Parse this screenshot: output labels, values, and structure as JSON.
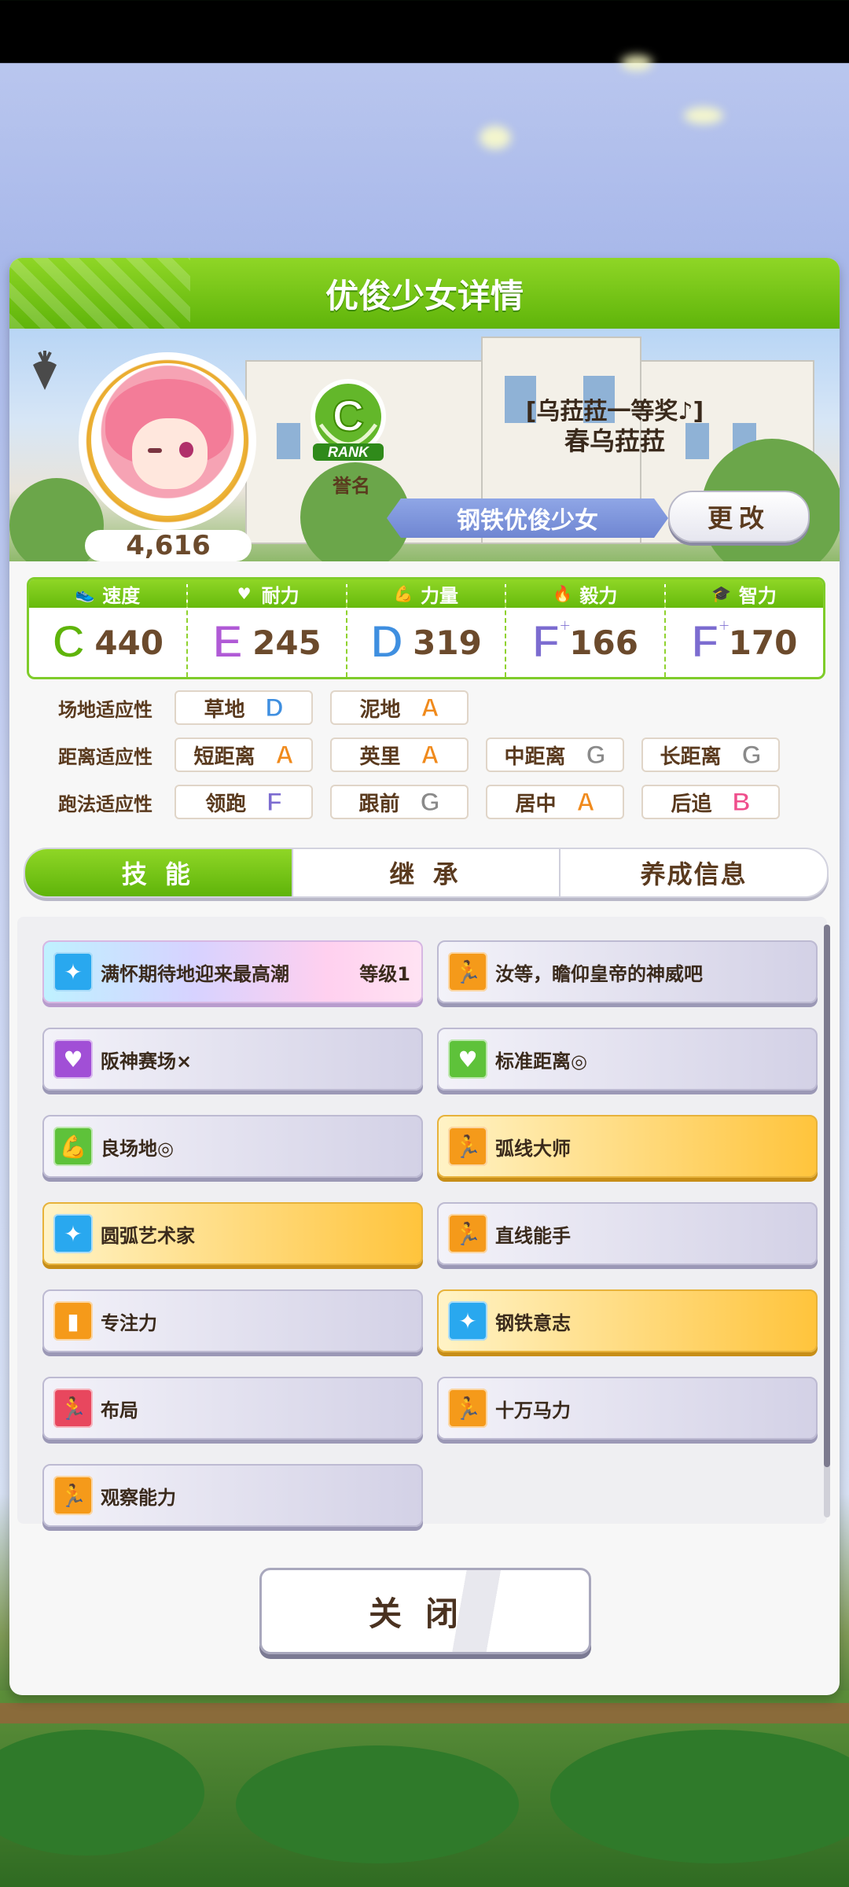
{
  "dialog": {
    "title": "优俊少女详情"
  },
  "profile": {
    "score": "4,616",
    "rank_letter": "C",
    "rank_text": "RANK",
    "rank_caption": "誉名",
    "title": "[乌菈菈一等奖♪]",
    "name": "春乌菈菈",
    "epithet": "钢铁优俊少女",
    "change_label": "更改"
  },
  "stats": [
    {
      "label": "速度",
      "icon": "shoe-icon",
      "grade": "C",
      "plus": "",
      "value": "440",
      "color": "#5fb40a"
    },
    {
      "label": "耐力",
      "icon": "heart-icon",
      "grade": "E",
      "plus": "",
      "value": "245",
      "color": "#b05ad6"
    },
    {
      "label": "力量",
      "icon": "muscle-icon",
      "grade": "D",
      "plus": "",
      "value": "319",
      "color": "#3f8fe0"
    },
    {
      "label": "毅力",
      "icon": "flame-icon",
      "grade": "F",
      "plus": "+",
      "value": "166",
      "color": "#7c6cd0"
    },
    {
      "label": "智力",
      "icon": "graduation-cap-icon",
      "grade": "F",
      "plus": "+",
      "value": "170",
      "color": "#7c6cd0"
    }
  ],
  "aptitude": {
    "rows": [
      {
        "label": "场地适应性",
        "cells": [
          {
            "name": "草地",
            "grade": "D",
            "color": "#3f8fe0"
          },
          {
            "name": "泥地",
            "grade": "A",
            "color": "#f08a1c"
          }
        ]
      },
      {
        "label": "距离适应性",
        "cells": [
          {
            "name": "短距离",
            "grade": "A",
            "color": "#f08a1c"
          },
          {
            "name": "英里",
            "grade": "A",
            "color": "#f08a1c"
          },
          {
            "name": "中距离",
            "grade": "G",
            "color": "#8a8a8a"
          },
          {
            "name": "长距离",
            "grade": "G",
            "color": "#8a8a8a"
          }
        ]
      },
      {
        "label": "跑法适应性",
        "cells": [
          {
            "name": "领跑",
            "grade": "F",
            "color": "#7c6cd0"
          },
          {
            "name": "跟前",
            "grade": "G",
            "color": "#8a8a8a"
          },
          {
            "name": "居中",
            "grade": "A",
            "color": "#f08a1c"
          },
          {
            "name": "后追",
            "grade": "B",
            "color": "#ef4f8c"
          }
        ]
      }
    ]
  },
  "tabs": [
    {
      "label": "技 能",
      "active": true
    },
    {
      "label": "继 承",
      "active": false
    },
    {
      "label": "养成信息",
      "active": false
    }
  ],
  "skills": [
    {
      "name": "满怀期待地迎来最高潮",
      "level": "等级1",
      "style": "rainbow",
      "icon": "sparkle-icon",
      "icon_color": "#29a8ef"
    },
    {
      "name": "汝等，瞻仰皇帝的神威吧",
      "level": "",
      "style": "plain",
      "icon": "runner-icon",
      "icon_color": "#f59a1a"
    },
    {
      "name": "阪神赛场×",
      "level": "",
      "style": "plain",
      "icon": "heart-icon",
      "icon_color": "#a14fd6"
    },
    {
      "name": "标准距离◎",
      "level": "",
      "style": "plain",
      "icon": "heart-icon",
      "icon_color": "#5ec23a"
    },
    {
      "name": "良场地◎",
      "level": "",
      "style": "plain",
      "icon": "muscle-icon",
      "icon_color": "#5ec23a"
    },
    {
      "name": "弧线大师",
      "level": "",
      "style": "gold",
      "icon": "runner-icon",
      "icon_color": "#f59a1a"
    },
    {
      "name": "圆弧艺术家",
      "level": "",
      "style": "gold",
      "icon": "sparkle-icon",
      "icon_color": "#29a8ef"
    },
    {
      "name": "直线能手",
      "level": "",
      "style": "plain",
      "icon": "runner-icon",
      "icon_color": "#f59a1a"
    },
    {
      "name": "专注力",
      "level": "",
      "style": "plain",
      "icon": "gate-icon",
      "icon_color": "#f59a1a"
    },
    {
      "name": "钢铁意志",
      "level": "",
      "style": "gold",
      "icon": "sparkle-icon",
      "icon_color": "#29a8ef"
    },
    {
      "name": "布局",
      "level": "",
      "style": "plain",
      "icon": "runner-icon",
      "icon_color": "#e8475e"
    },
    {
      "name": "十万马力",
      "level": "",
      "style": "plain",
      "icon": "runner-icon",
      "icon_color": "#f59a1a"
    },
    {
      "name": "观察能力",
      "level": "",
      "style": "plain",
      "icon": "runner-icon",
      "icon_color": "#f59a1a"
    }
  ],
  "close_label": "关闭"
}
